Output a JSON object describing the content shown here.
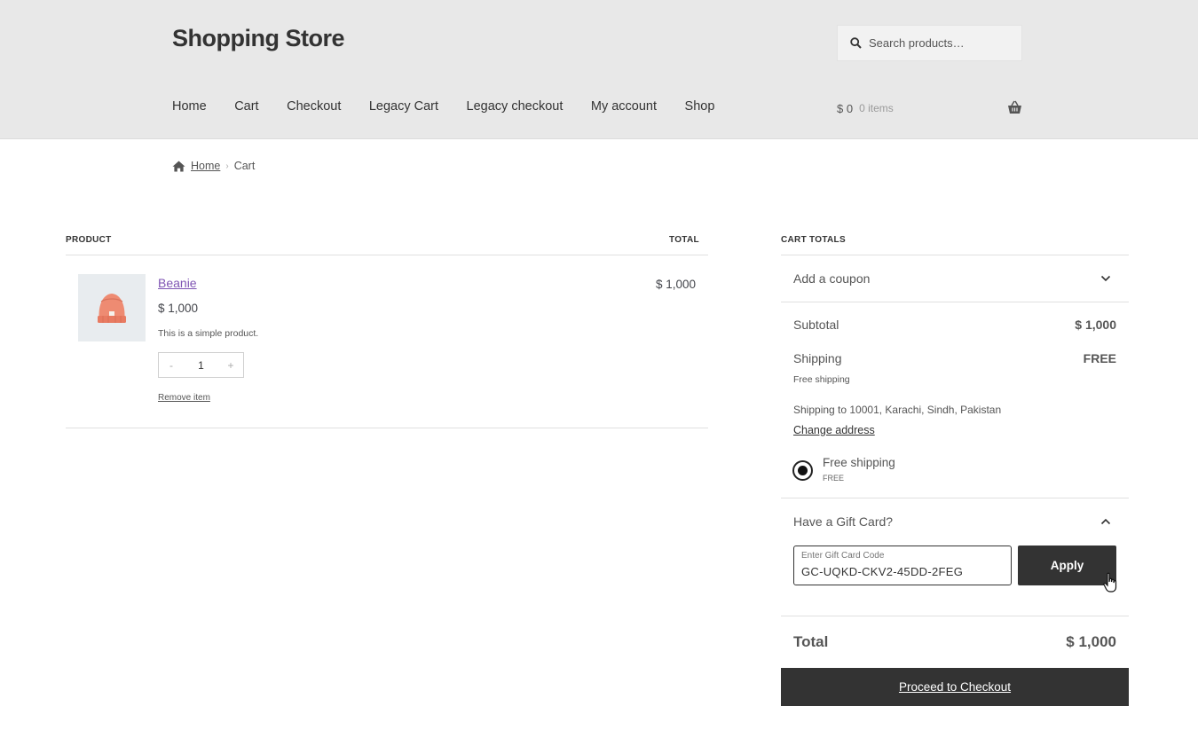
{
  "header": {
    "site_title": "Shopping Store",
    "search_placeholder": "Search products…",
    "nav": [
      "Home",
      "Cart",
      "Checkout",
      "Legacy Cart",
      "Legacy checkout",
      "My account",
      "Shop"
    ],
    "mini_cart": {
      "amount": "$ 0",
      "count": "0 items"
    }
  },
  "breadcrumb": {
    "home": "Home",
    "current": "Cart"
  },
  "cart_table": {
    "headers": {
      "product": "PRODUCT",
      "total": "TOTAL"
    },
    "item": {
      "name": "Beanie",
      "price": "$ 1,000",
      "description": "This is a simple product.",
      "quantity": "1",
      "minus": "-",
      "plus": "+",
      "remove": "Remove item",
      "line_total": "$ 1,000"
    }
  },
  "totals": {
    "heading": "CART TOTALS",
    "coupon": "Add a coupon",
    "subtotal_label": "Subtotal",
    "subtotal_value": "$ 1,000",
    "shipping_label": "Shipping",
    "shipping_value": "FREE",
    "shipping_method_small": "Free shipping",
    "shipping_to": "Shipping to 10001, Karachi, Sindh, Pakistan",
    "change_address": "Change address",
    "option_label": "Free shipping",
    "option_price": "FREE",
    "gift_card_toggle": "Have a Gift Card?",
    "gift_card_field_label": "Enter Gift Card Code",
    "gift_card_code": "GC-UQKD-CKV2-45DD-2FEG",
    "apply": "Apply",
    "total_label": "Total",
    "total_value": "$ 1,000",
    "checkout": "Proceed to Checkout"
  },
  "colors": {
    "link_purple": "#7f54b3",
    "dark_button": "#333333",
    "header_bg": "#e8e8e8"
  }
}
